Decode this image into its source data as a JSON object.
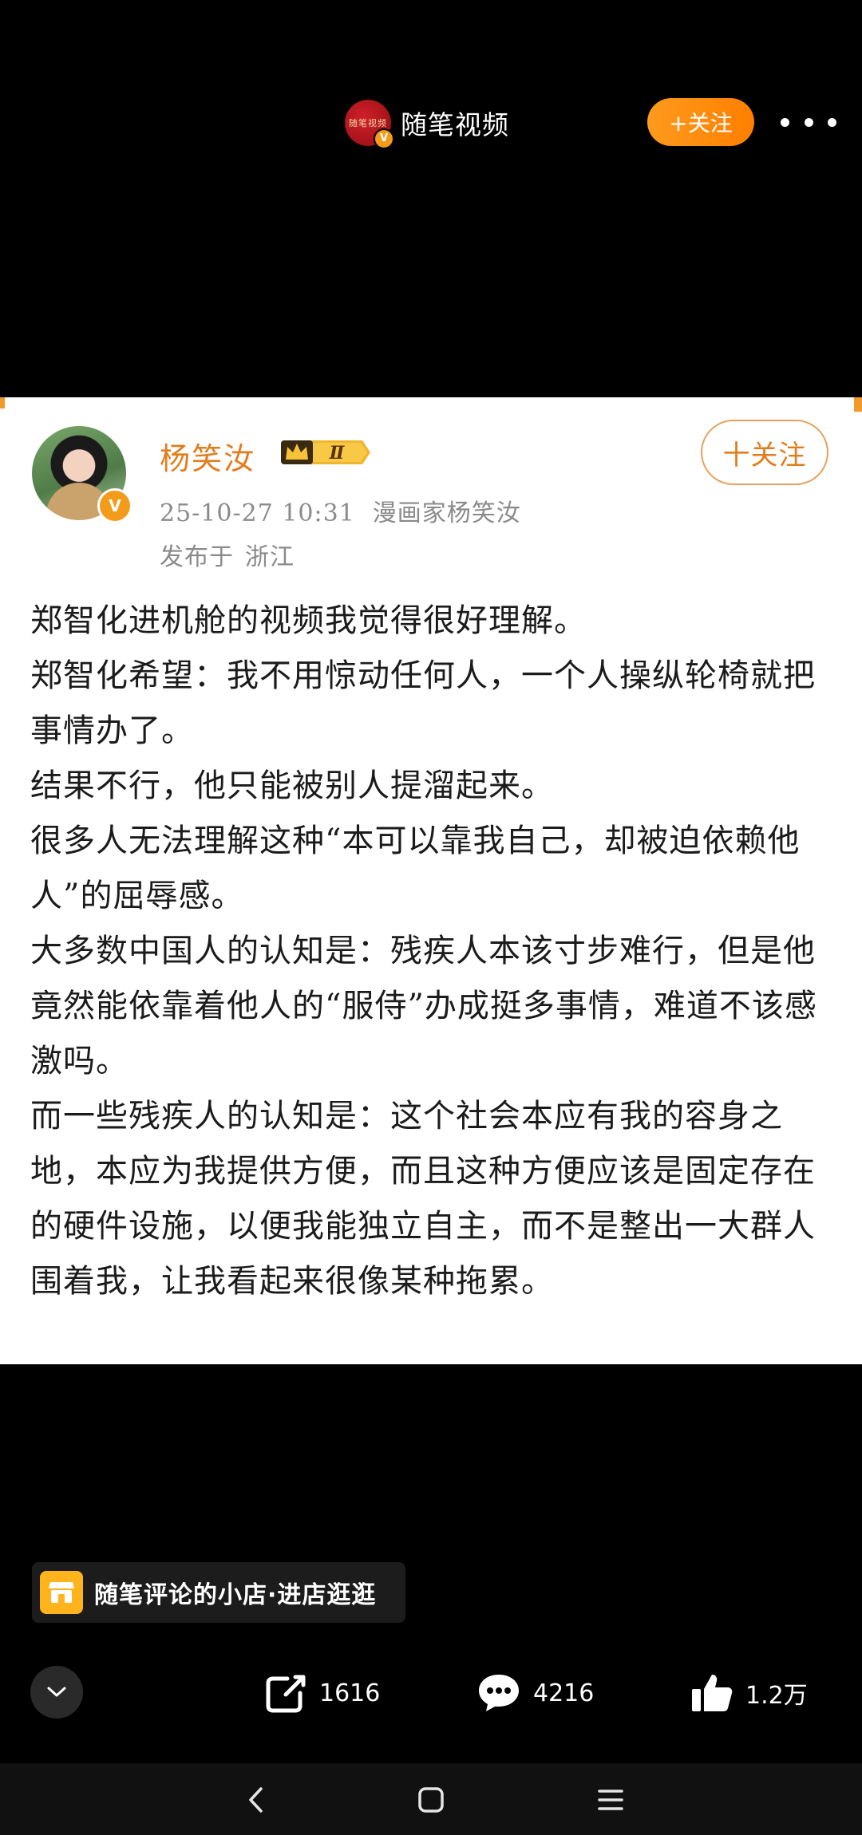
{
  "top_bar": {
    "channel_name": "随笔视频",
    "channel_avatar_text": "随笔视频",
    "verified_badge": "V",
    "follow_label": "+关注",
    "more_icon": "more-dots-icon"
  },
  "post": {
    "author_name": "杨笑汝",
    "vip_level": "Ⅱ",
    "verified_badge": "V",
    "timestamp": "25-10-27 10:31",
    "source": "漫画家杨笑汝",
    "location_prefix": "发布于",
    "location": "浙江",
    "follow_label": "十关注",
    "paragraphs": [
      "郑智化进机舱的视频我觉得很好理解。",
      "郑智化希望：我不用惊动任何人，一个人操纵轮椅就把事情办了。",
      "结果不行，他只能被别人提溜起来。",
      "很多人无法理解这种“本可以靠我自己，却被迫依赖他人”的屈辱感。",
      "大多数中国人的认知是：残疾人本该寸步难行，但是他竟然能依靠着他人的“服侍”办成挺多事情，难道不该感激吗。",
      "而一些残疾人的认知是：这个社会本应有我的容身之地，本应为我提供方便，而且这种方便应该是固定存在的硬件设施，以便我能独立自主，而不是整出一大群人围着我，让我看起来很像某种拖累。"
    ]
  },
  "shop": {
    "label": "随笔评论的小店·进店逛逛",
    "icon": "shop-icon"
  },
  "actions": {
    "share_count": "1616",
    "comment_count": "4216",
    "like_count": "1.2万"
  },
  "colors": {
    "accent": "#ff8a00",
    "author": "#e27d1e",
    "meta": "#8a8a8a"
  }
}
